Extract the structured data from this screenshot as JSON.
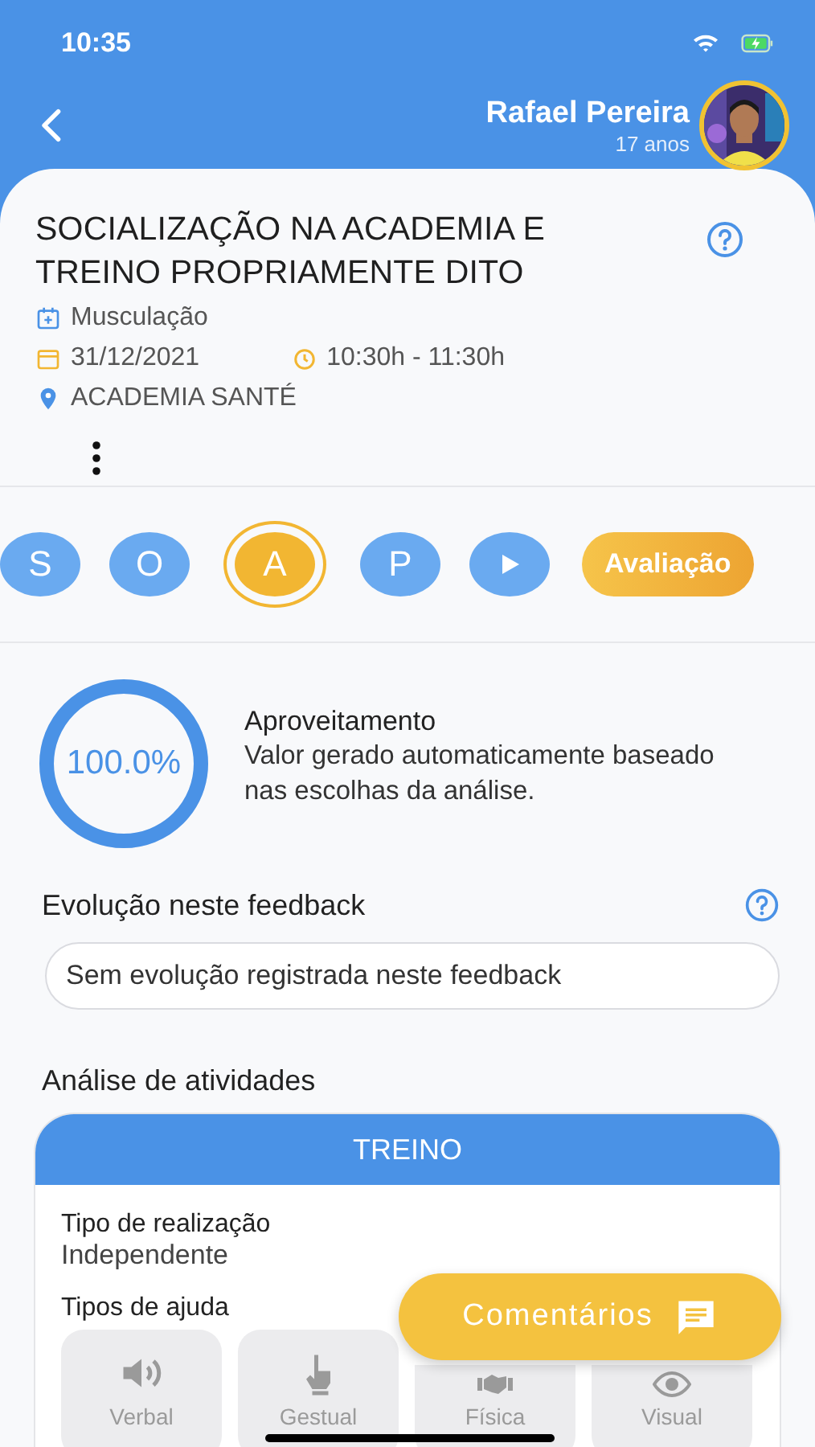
{
  "status_bar": {
    "time": "10:35"
  },
  "header": {
    "name": "Rafael Pereira",
    "age": "17 anos"
  },
  "session": {
    "title": "SOCIALIZAÇÃO NA ACADEMIA E TREINO PROPRIAMENTE DITO",
    "category": "Musculação",
    "date": "31/12/2021",
    "time": "10:30h - 11:30h",
    "location": "ACADEMIA SANTÉ"
  },
  "steps": [
    {
      "kind": "letter",
      "label": "S",
      "selected": false
    },
    {
      "kind": "letter",
      "label": "O",
      "selected": false
    },
    {
      "kind": "letter",
      "label": "A",
      "selected": true
    },
    {
      "kind": "letter",
      "label": "P",
      "selected": false
    },
    {
      "kind": "play",
      "selected": false
    }
  ],
  "evaluation_button": "Avaliação",
  "score": {
    "value": "100.0%",
    "level": 1,
    "title": "Aproveitamento",
    "description": "Valor gerado automaticamente baseado nas escolhas da análise."
  },
  "evolution": {
    "title": "Evolução neste feedback",
    "message": "Sem evolução registrada neste feedback"
  },
  "analysis": {
    "title": "Análise de atividades",
    "card": {
      "header": "TREINO",
      "fields": [
        {
          "label": "Tipo de realização",
          "value": "Independente"
        }
      ],
      "help_title": "Tipos de ajuda",
      "help_types": [
        {
          "kind": "verbal",
          "label": "Verbal"
        },
        {
          "kind": "gestual",
          "label": "Gestual"
        },
        {
          "kind": "fisica",
          "label": "Física"
        },
        {
          "kind": "visual",
          "label": "Visual"
        }
      ]
    }
  },
  "comments_button": "Comentários"
}
